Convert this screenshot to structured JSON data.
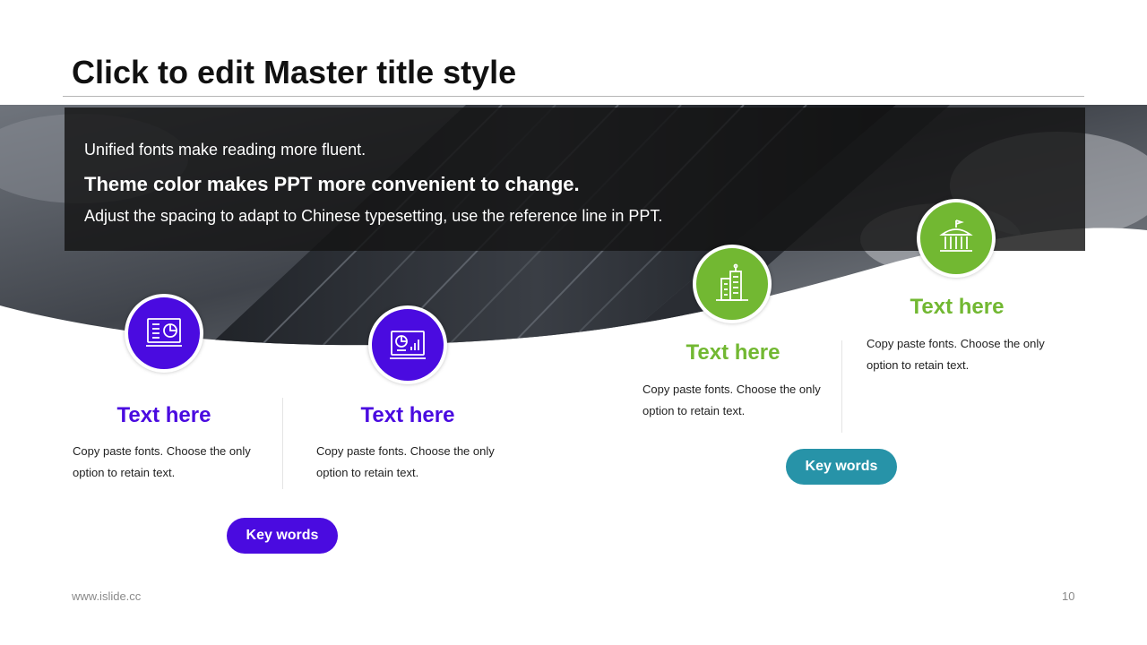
{
  "slide": {
    "title": "Click to edit Master title style",
    "page_number": "10",
    "website": "www.islide.cc"
  },
  "banner": {
    "line1": "Unified fonts make reading more fluent.",
    "line2": "Theme color makes PPT more convenient to change.",
    "line3": "Adjust the spacing to adapt to Chinese typesetting, use the reference line in PPT."
  },
  "items": [
    {
      "heading": "Text here",
      "body": "Copy paste fonts. Choose the only option to retain text.",
      "icon": "presentation-board-icon"
    },
    {
      "heading": "Text here",
      "body": "Copy paste fonts. Choose the only option to retain text.",
      "icon": "analytics-chart-icon"
    },
    {
      "heading": "Text here",
      "body": "Copy paste fonts. Choose the only option to retain text.",
      "icon": "office-building-icon"
    },
    {
      "heading": "Text here",
      "body": "Copy paste fonts. Choose the only option to retain text.",
      "icon": "government-building-icon"
    }
  ],
  "keywords": [
    "Key words",
    "Key words"
  ],
  "colors": {
    "purple": "#4a0be0",
    "green": "#72b832",
    "teal": "#2793a8",
    "banner": "#141414"
  }
}
